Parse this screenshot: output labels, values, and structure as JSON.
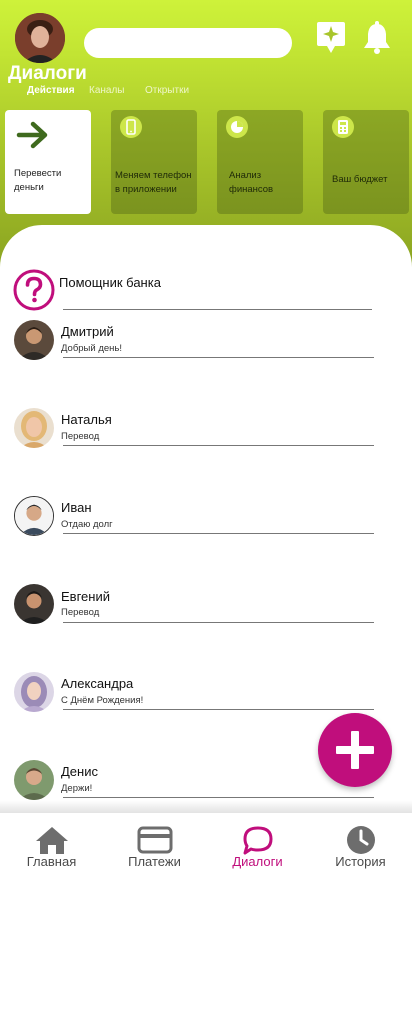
{
  "header": {
    "title": "Диалоги",
    "subtabs": [
      "Действия",
      "Каналы",
      "Открытки"
    ],
    "search_placeholder": ""
  },
  "cards": [
    {
      "label": "Перевести деньги",
      "icon": "arrow-right-icon"
    },
    {
      "label": "Меняем телефон в приложении",
      "icon": "phone-icon"
    },
    {
      "label": "Анализ финансов",
      "icon": "pie-chart-icon"
    },
    {
      "label": "Ваш бюджет",
      "icon": "calculator-icon"
    }
  ],
  "assistant": {
    "name": "Помощник банка",
    "icon": "question-icon"
  },
  "dialogs": [
    {
      "name": "Дмитрий",
      "message": "Добрый день!"
    },
    {
      "name": "Наталья",
      "message": "Перевод"
    },
    {
      "name": "Иван",
      "message": "Отдаю долг"
    },
    {
      "name": "Евгений",
      "message": "Перевод"
    },
    {
      "name": "Александра",
      "message": "С Днём Рождения!"
    },
    {
      "name": "Денис",
      "message": "Держи!"
    }
  ],
  "nav": [
    {
      "label": "Главная",
      "icon": "home-icon"
    },
    {
      "label": "Платежи",
      "icon": "card-icon"
    },
    {
      "label": "Диалоги",
      "icon": "chat-icon"
    },
    {
      "label": "История",
      "icon": "clock-icon"
    }
  ],
  "colors": {
    "accent": "#c00e7c",
    "header_top": "#cef23a",
    "header_bottom": "#8aa321"
  }
}
